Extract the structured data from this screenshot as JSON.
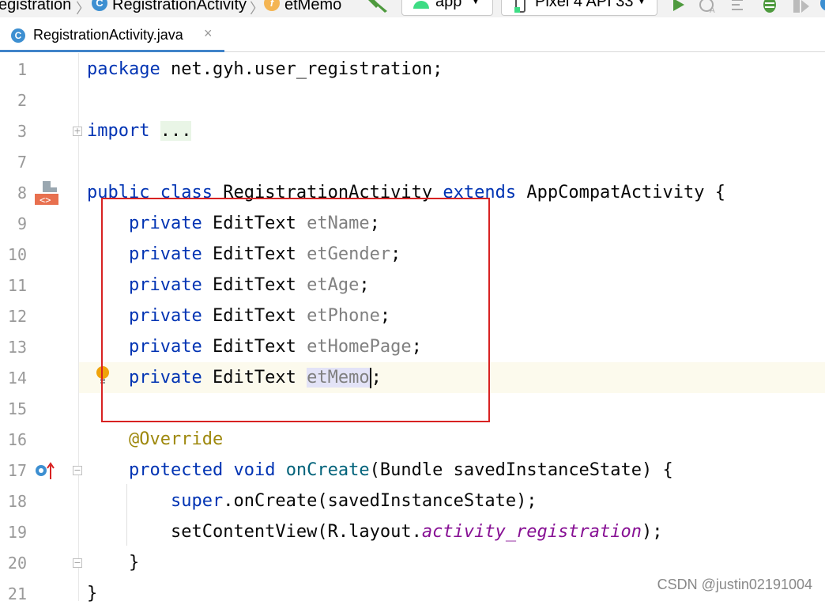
{
  "breadcrumbs": {
    "project": "egistration",
    "class": "RegistrationActivity",
    "field": "etMemo"
  },
  "toolbar": {
    "run_config": "app",
    "device": "Pixel 4 API 33"
  },
  "tab": {
    "label": "RegistrationActivity.java",
    "close": "×"
  },
  "line_numbers": [
    "1",
    "2",
    "3",
    "7",
    "8",
    "9",
    "10",
    "11",
    "12",
    "13",
    "14",
    "15",
    "16",
    "17",
    "18",
    "19",
    "20",
    "21"
  ],
  "code": {
    "package_kw": "package",
    "package_name": " net.gyh.user_registration;",
    "import_kw": "import",
    "import_dots": "...",
    "public_kw": "public",
    "class_kw": "class",
    "class_name": "RegistrationActivity",
    "extends_kw": "extends",
    "super_class": "AppCompatActivity {",
    "private_kw": "private",
    "edit_text": "EditText",
    "fields": [
      "etName",
      "etGender",
      "etAge",
      "etPhone",
      "etHomePage",
      "etMemo"
    ],
    "semicolon": ";",
    "override": "@Override",
    "protected_kw": "protected",
    "void_kw": "void",
    "on_create": "onCreate",
    "params": "(Bundle savedInstanceState) {",
    "super_kw": "super",
    "super_call": ".onCreate(savedInstanceState);",
    "set_content": "setContentView(R.layout.",
    "layout_name": "activity_registration",
    "close_call": ");",
    "brace": "}"
  },
  "watermark": "CSDN @justin02191004",
  "colors": {
    "keyword": "#0033b3",
    "field_gray": "#808080",
    "annotation": "#9e880d",
    "method": "#00627a",
    "highlight_box": "#d82222"
  }
}
